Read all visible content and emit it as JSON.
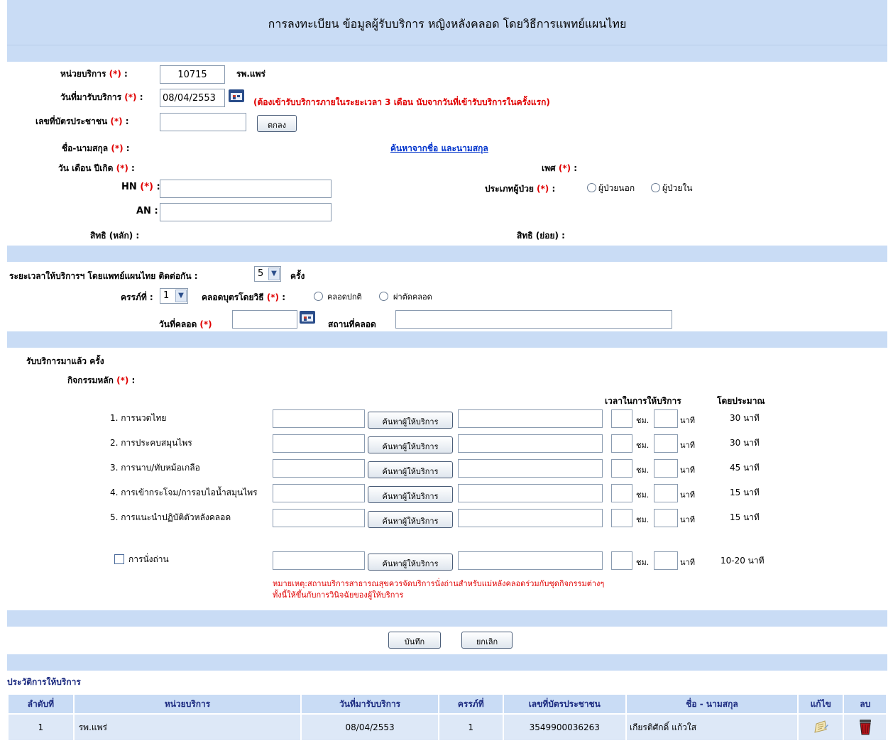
{
  "title": "การลงทะเบียน ข้อมูลผู้รับบริการ หญิงหลังคลอด โดยวิธีการแพทย์แผนไทย",
  "req_mark": "(*)",
  "form": {
    "unit_label": "หน่วยบริการ",
    "unit_code": "10715",
    "unit_name": "รพ.แพร่",
    "date_label": "วันที่มารับบริการ",
    "date_value": "08/04/2553",
    "date_warning": "(ต้องเข้ารับบริการภายในระยะเวลา 3 เดือน นับจากวันที่เข้ารับบริการในครั้งแรก)",
    "id_label": "เลขที่บัตรประชาชน",
    "id_value": "",
    "ok_button": "ตกลง",
    "name_label": "ชื่อ-นามสกุล",
    "search_name_link": "ค้นหาจากชื่อ และนามสกุล",
    "dob_label": "วัน เดือน ปีเกิด",
    "sex_label": "เพศ",
    "hn_label": "HN",
    "an_label": "AN",
    "patient_type_label": "ประเภทผู้ป่วย",
    "patient_type_options": [
      "ผู้ป่วยนอก",
      "ผู้ป่วยใน"
    ],
    "right_main_label": "สิทธิ (หลัก)",
    "right_sub_label": "สิทธิ (ย่อย)"
  },
  "period": {
    "label": "ระยะเวลาให้บริการฯ โดยแพทย์แผนไทย ติดต่อกัน :",
    "value": "5",
    "unit": "ครั้ง",
    "pregnancy_label": "ครรภ์ที่ :",
    "pregnancy_value": "1",
    "delivery_method_label": "คลอดบุตรโดยวิธี",
    "delivery_options": [
      "คลอดปกติ",
      "ผ่าตัดคลอด"
    ],
    "delivery_date_label": "วันที่คลอด",
    "delivery_place_label": "สถานที่คลอด"
  },
  "activities": {
    "received_label": "รับบริการมาแล้ว ครั้ง",
    "main_label": "กิจกรรมหลัก",
    "time_header": "เวลาในการให้บริการ",
    "approx_header": "โดยประมาณ",
    "search_button": "ค้นหาผู้ให้บริการ",
    "hour_unit": "ชม.",
    "min_unit": "นาที",
    "items": [
      {
        "name": "1. การนวดไทย",
        "approx": "30 นาที"
      },
      {
        "name": "2. การประคบสมุนไพร",
        "approx": "30 นาที"
      },
      {
        "name": "3. การนาบ/ทับหม้อเกลือ",
        "approx": "45 นาที"
      },
      {
        "name": "4. การเข้ากระโจม/การอบไอน้ำสมุนไพร",
        "approx": "15 นาที"
      },
      {
        "name": "5. การแนะนำปฏิบัติตัวหลังคลอด",
        "approx": "15 นาที"
      }
    ],
    "extra": {
      "name": "การนั่งถ่าน",
      "approx": "10-20 นาที"
    },
    "note_line1": "หมายเหตุ:สถานบริการสาธารณสุขควรจัดบริการนั่งถ่านสำหรับแม่หลังคลอดร่วมกับชุดกิจกรรมต่างๆ",
    "note_line2": "ทั้งนี้ให้ขึ้นกับการวินิจฉัยของผู้ให้บริการ"
  },
  "actions": {
    "save": "บันทึก",
    "cancel": "ยกเลิก"
  },
  "history": {
    "title": "ประวัติการให้บริการ",
    "columns": [
      "ลำดับที่",
      "หน่วยบริการ",
      "วันที่มารับบริการ",
      "ครรภ์ที่",
      "เลขที่บัตรประชาชน",
      "ชื่อ - นามสกุล",
      "แก้ไข",
      "ลบ"
    ],
    "rows": [
      {
        "no": "1",
        "unit": "รพ.แพร่",
        "date": "08/04/2553",
        "pregnancy": "1",
        "id": "3549900036263",
        "name": "เกียรติศักดิ์ แก้วใส"
      }
    ]
  },
  "icons": {
    "calendar": "calendar-icon",
    "edit": "edit-icon",
    "delete": "trash-icon"
  },
  "colors": {
    "band": "#c9dcf5",
    "required": "#e00000",
    "link": "#0033cc",
    "header_text": "#1b2a80"
  }
}
